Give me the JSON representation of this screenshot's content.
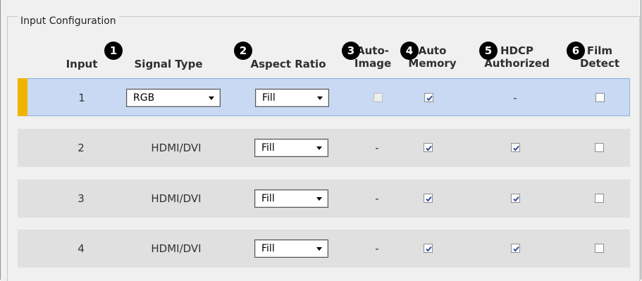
{
  "group_title": "Input Configuration",
  "badges": [
    "1",
    "2",
    "3",
    "4",
    "5",
    "6"
  ],
  "headers": {
    "input": "Input",
    "signal_type": "Signal Type",
    "aspect_ratio": "Aspect Ratio",
    "auto_image": [
      "Auto-",
      "Image"
    ],
    "auto_memory": [
      "Auto",
      "Memory"
    ],
    "hdcp": [
      "HDCP",
      "Authorized"
    ],
    "film": [
      "Film",
      "Detect"
    ]
  },
  "rows": [
    {
      "input": "1",
      "signal_type": "RGB",
      "signal_is_dropdown": true,
      "aspect_ratio": "Fill",
      "auto_image": false,
      "auto_image_text": "",
      "auto_memory": true,
      "hdcp": "-",
      "hdcp_checked": null,
      "film_detect": false,
      "selected": true
    },
    {
      "input": "2",
      "signal_type": "HDMI/DVI",
      "signal_is_dropdown": false,
      "aspect_ratio": "Fill",
      "auto_image": null,
      "auto_image_text": "-",
      "auto_memory": true,
      "hdcp": "",
      "hdcp_checked": true,
      "film_detect": false,
      "selected": false
    },
    {
      "input": "3",
      "signal_type": "HDMI/DVI",
      "signal_is_dropdown": false,
      "aspect_ratio": "Fill",
      "auto_image": null,
      "auto_image_text": "-",
      "auto_memory": true,
      "hdcp": "",
      "hdcp_checked": true,
      "film_detect": false,
      "selected": false
    },
    {
      "input": "4",
      "signal_type": "HDMI/DVI",
      "signal_is_dropdown": false,
      "aspect_ratio": "Fill",
      "auto_image": null,
      "auto_image_text": "-",
      "auto_memory": true,
      "hdcp": "",
      "hdcp_checked": true,
      "film_detect": false,
      "selected": false
    }
  ],
  "colors": {
    "selected_row": "#c9d9f3",
    "row": "#e0e0e0",
    "indicator": "#f0b400",
    "check": "#3a4a9a"
  }
}
